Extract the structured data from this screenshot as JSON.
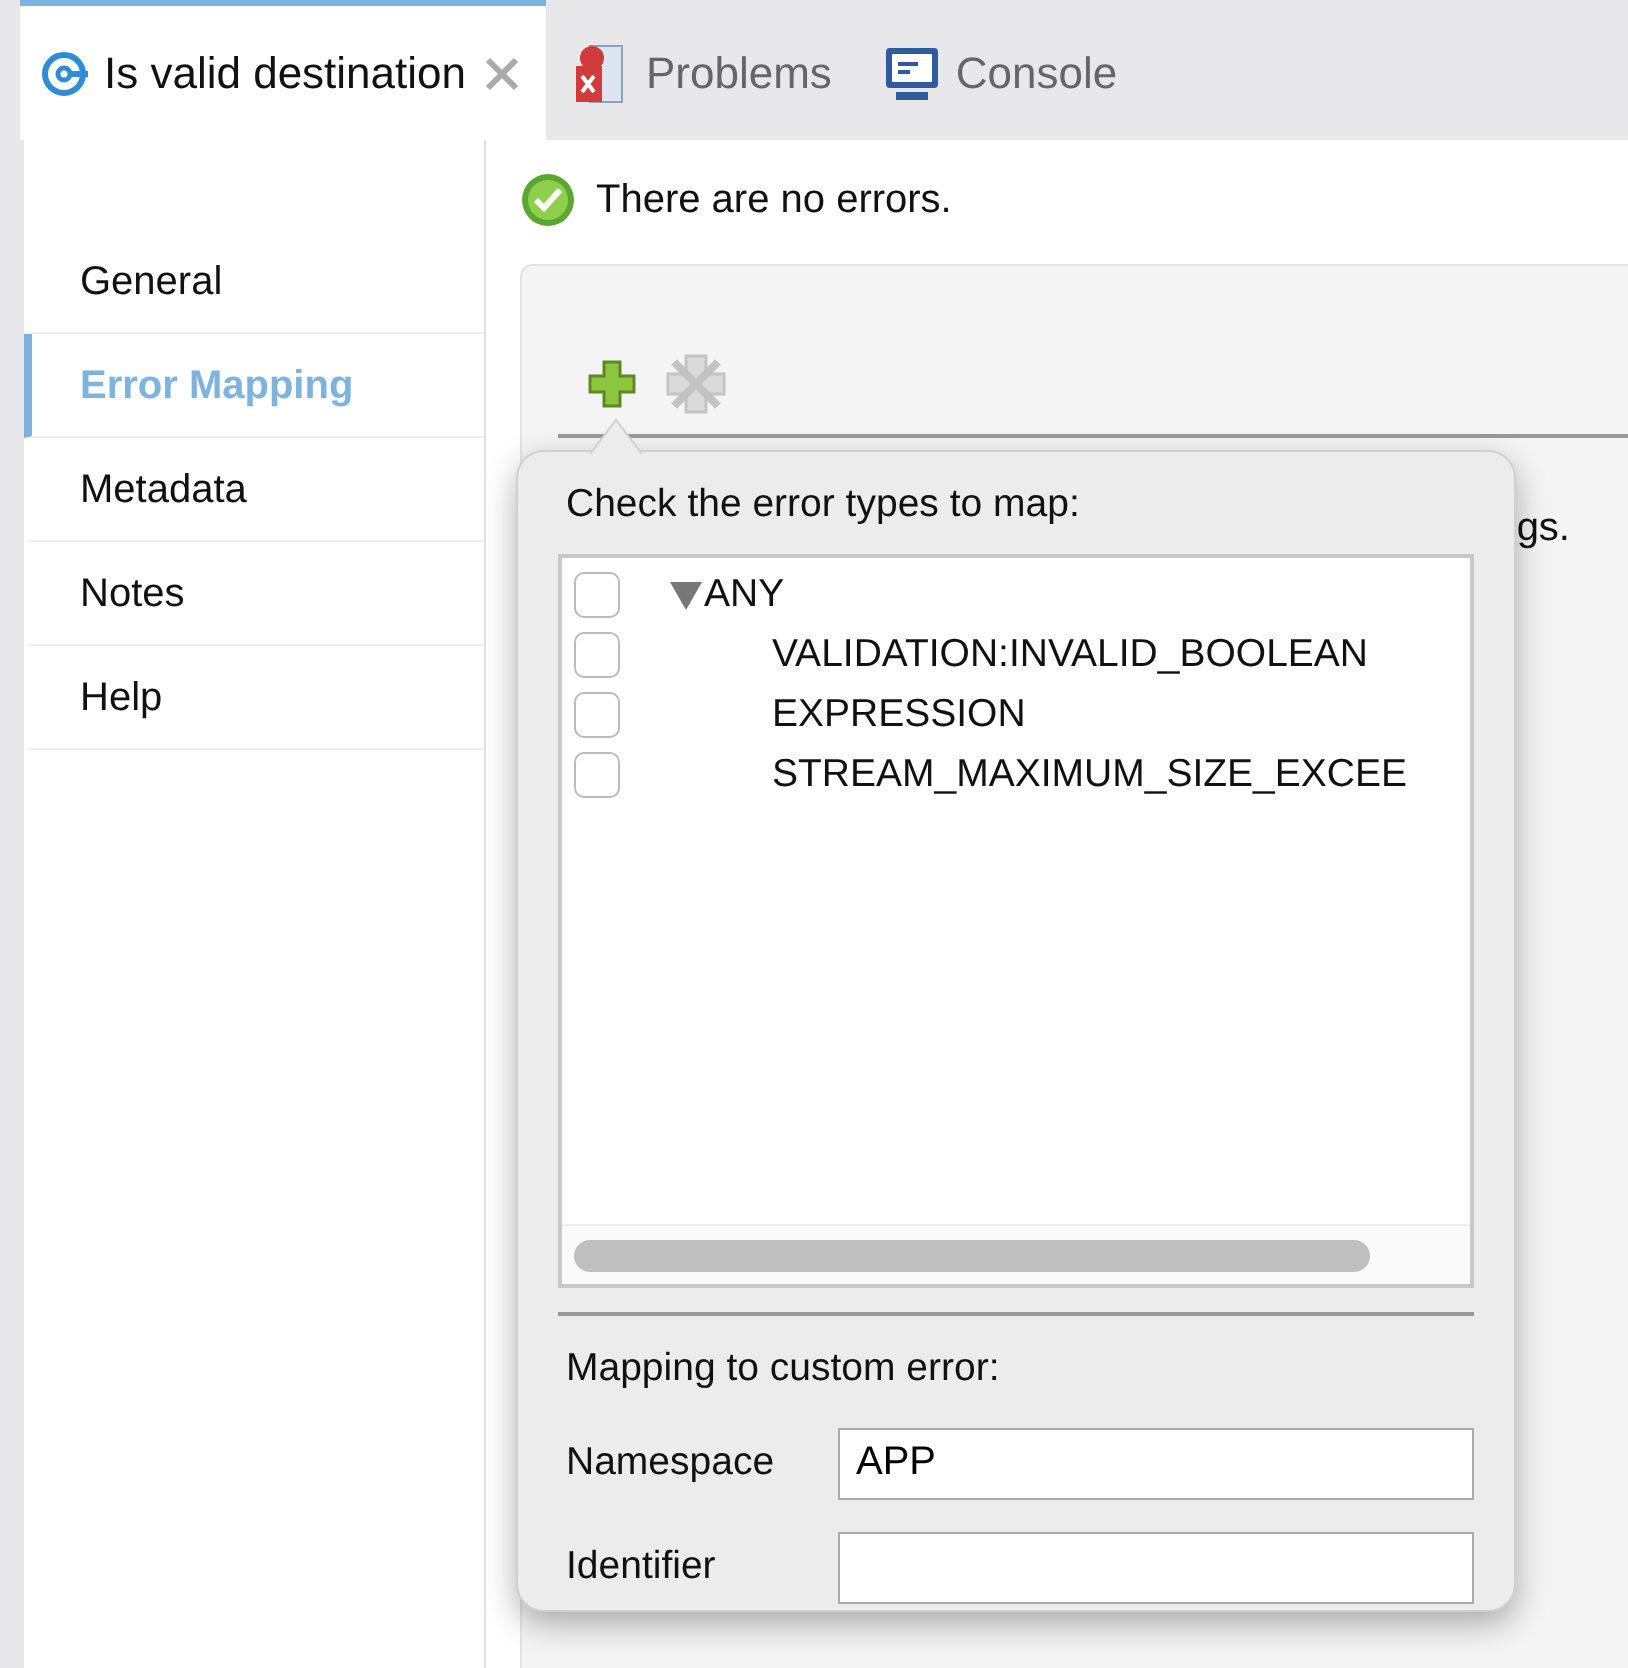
{
  "tabs": [
    {
      "label": "Is valid destination",
      "selected": true,
      "closable": true,
      "kind": "flow"
    },
    {
      "label": "Problems",
      "selected": false,
      "closable": false,
      "kind": "problems"
    },
    {
      "label": "Console",
      "selected": false,
      "closable": false,
      "kind": "console"
    }
  ],
  "sidebar": {
    "items": [
      {
        "label": "General",
        "selected": false
      },
      {
        "label": "Error Mapping",
        "selected": true
      },
      {
        "label": "Metadata",
        "selected": false
      },
      {
        "label": "Notes",
        "selected": false
      },
      {
        "label": "Help",
        "selected": false
      }
    ]
  },
  "status": {
    "kind": "ok",
    "text": "There are no errors."
  },
  "toolbar": [
    {
      "kind": "add",
      "disabled": false
    },
    {
      "kind": "remove",
      "disabled": true
    }
  ],
  "panel_text": "gs.",
  "popup": {
    "heading": "Check the error types to map:",
    "tree": [
      {
        "label": "ANY",
        "checked": false,
        "expanded": true,
        "children": [
          {
            "label": "VALIDATION:INVALID_BOOLEAN",
            "checked": false
          },
          {
            "label": "EXPRESSION",
            "checked": false
          },
          {
            "label": "STREAM_MAXIMUM_SIZE_EXCEE",
            "checked": false
          }
        ]
      }
    ],
    "mapping_heading": "Mapping to custom error:",
    "fields": [
      {
        "label": "Namespace",
        "value": "APP"
      },
      {
        "label": "Identifier"
      }
    ]
  }
}
